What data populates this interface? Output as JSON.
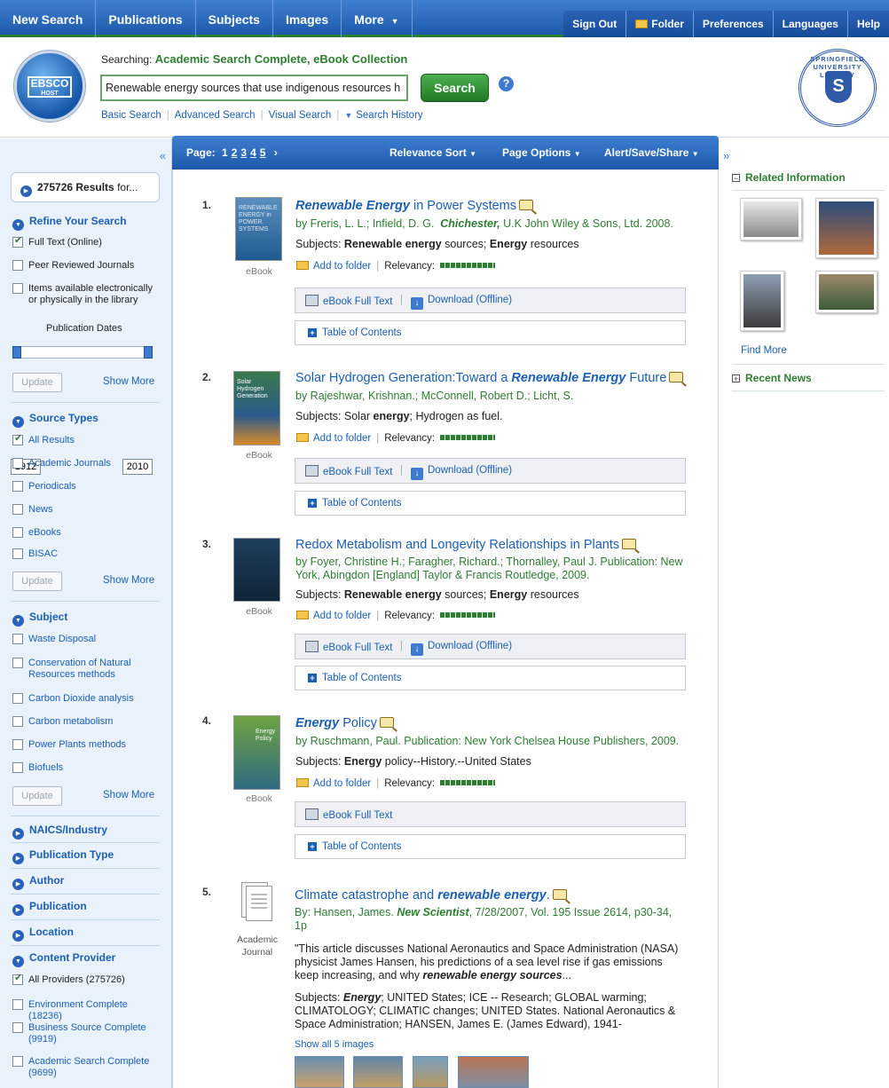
{
  "topnav": {
    "left": [
      "New Search",
      "Publications",
      "Subjects",
      "Images",
      "More"
    ],
    "right": [
      "Sign Out",
      "Folder",
      "Preferences",
      "Languages",
      "Help"
    ]
  },
  "header": {
    "logo_text": "EBSCO",
    "logo_sub": "HOST",
    "searching_label": "Searching:",
    "searching_dbs": "Academic Search Complete, eBook Collection",
    "query": "Renewable energy sources that use indigenous resources h",
    "search_button": "Search",
    "help": "?",
    "links": [
      "Basic Search",
      "Advanced Search",
      "Visual Search",
      "Search History"
    ],
    "seal_text": "SPRINGFIELD UNIVERSITY LIBRARY",
    "seal_letter": "S"
  },
  "sidebar": {
    "results_count": "275726 Results",
    "results_suffix": " for...",
    "refine": "Refine Your Search",
    "refine_items": [
      "Full Text (Online)",
      "Peer Reviewed Journals",
      "Items available electronically or physically in the library"
    ],
    "pub_dates_label": "Publication Dates",
    "date_from": "1912",
    "date_to": "2010",
    "update": "Update",
    "show_more": "Show More",
    "source_types": "Source Types",
    "source_items": [
      "All Results",
      "Academic Journals",
      "Periodicals",
      "News",
      "eBooks",
      "BISAC"
    ],
    "subject": "Subject",
    "subject_items": [
      "Waste Disposal",
      "Conservation of Natural Resources methods",
      "Carbon Dioxide analysis",
      "Carbon metabolism",
      "Power Plants methods",
      "Biofuels"
    ],
    "collapsed_sections": [
      "NAICS/Industry",
      "Publication Type",
      "Author",
      "Publication",
      "Location"
    ],
    "content_provider": "Content Provider",
    "provider_items": [
      "All Providers (275726)",
      "Environment Complete (18236)",
      "Business Source Complete (9919)",
      "Academic Search Complete (9699)"
    ]
  },
  "resultsbar": {
    "page_label": "Page:",
    "pages": [
      "1",
      "2",
      "3",
      "4",
      "5"
    ],
    "next": "›",
    "sort": "Relevance Sort",
    "page_options": "Page Options",
    "alert": "Alert/Save/Share"
  },
  "results": [
    {
      "num": "1.",
      "title_pre": "",
      "title_em": "Renewable Energy",
      "title_post": " in Power Systems",
      "by": "by Freris, L. L.; Infield, D. G.",
      "pub": "Chichester,",
      "by2": " U.K John Wiley & Sons, Ltd. 2008.",
      "subjects_pre": "Subjects: ",
      "subjects_b1": "Renewable energy",
      "subjects_mid": " sources; ",
      "subjects_b2": "Energy",
      "subjects_post": " resources",
      "type": "eBook",
      "thumb_text": "RENEWABLE ENERGY in POWER SYSTEMS"
    },
    {
      "num": "2.",
      "title_pre": "Solar Hydrogen Generation:Toward a ",
      "title_em": "Renewable Energy",
      "title_post": " Future",
      "by": "by Rajeshwar, Krishnan.; McConnell, Robert D.; Licht, S.",
      "subjects_pre": "Subjects: Solar ",
      "subjects_b1": "energy",
      "subjects_mid": "; Hydrogen as fuel.",
      "type": "eBook",
      "thumb_text": "Solar Hydrogen Generation"
    },
    {
      "num": "3.",
      "title": "Redox Metabolism and Longevity Relationships in Plants",
      "by": "by Foyer, Christine H.; Faragher, Richard.; Thornalley, Paul J.  Publication: New York, Abingdon [England] Taylor & Francis Routledge, 2009.",
      "subjects_pre": "Subjects: ",
      "subjects_b1": "Renewable energy",
      "subjects_mid": " sources; ",
      "subjects_b2": "Energy",
      "subjects_post": " resources",
      "type": "eBook"
    },
    {
      "num": "4.",
      "title_em": "Energy",
      "title_post": " Policy",
      "by": "by Ruschmann, Paul.  Publication: New York Chelsea House Publishers, 2009.",
      "subjects_pre": "Subjects: ",
      "subjects_b1": "Energy",
      "subjects_mid": " policy--History.--United States",
      "type": "eBook",
      "thumb_text": "Energy Policy"
    },
    {
      "num": "5.",
      "title_pre": "Climate catastrophe and ",
      "title_em": "renewable energy",
      "title_post": ".",
      "by_pre": "By: Hansen, James. ",
      "pub": "New Scientist",
      "by_post": ", 7/28/2007, Vol. 195 Issue 2614, p30-34, 1p",
      "abstract_pre": "\"This article discusses National Aeronautics and Space Administration (NASA) physicist James Hansen, his predictions of a sea level rise if gas emissions keep increasing, and why ",
      "abstract_em": "renewable energy sources",
      "abstract_post": "...",
      "subjects_pre": "Subjects: ",
      "subjects_b1": "Energy",
      "subjects_mid": "; UNITED States; ICE -- Research; GLOBAL warming; CLIMATOLOGY; CLIMATIC changes; UNITED States. National Aeronautics & Space Administration; HANSEN, James E. (James Edward), 1941-",
      "type1": "Academic",
      "type2": "Journal",
      "show_images": "Show all 5 images"
    }
  ],
  "result_actions": {
    "add_folder": "Add to folder",
    "relevancy": "Relevancy:",
    "ebook_full_text": "eBook Full Text",
    "download": "Download (Offline)",
    "toc": "Table of Contents"
  },
  "rsidebar": {
    "related": "Related Information",
    "find_more": "Find More",
    "recent_news": "Recent News"
  }
}
